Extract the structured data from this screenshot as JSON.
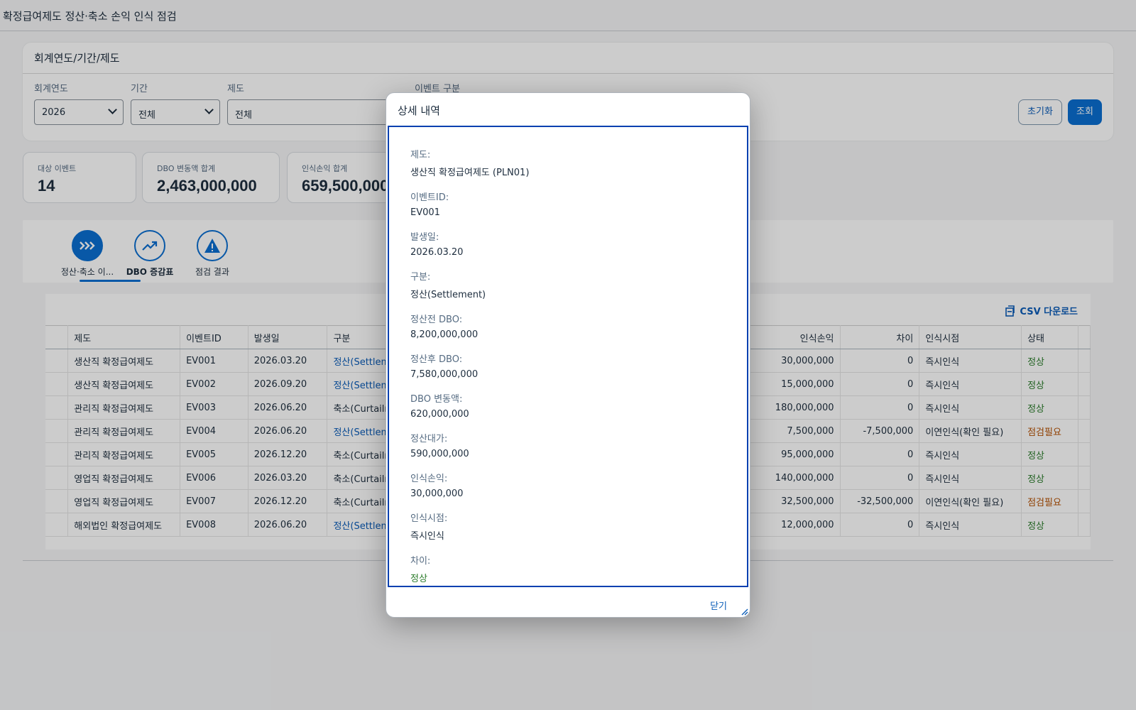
{
  "app": {
    "title": "확정급여제도 정산·축소 손익 인식 점검"
  },
  "filter": {
    "header": "회계연도/기간/제도",
    "year_label": "회계연도",
    "year_value": "2026",
    "period_label": "기간",
    "period_value": "전체",
    "plan_label": "제도",
    "plan_value": "전체",
    "event_label": "이벤트 구분",
    "reset_label": "초기화",
    "search_label": "조회"
  },
  "kpis": [
    {
      "label": "대상 이벤트",
      "value": "14"
    },
    {
      "label": "DBO 변동액 합계",
      "value": "2,463,000,000"
    },
    {
      "label": "인식손익 합계",
      "value": "659,500,000"
    }
  ],
  "tabs": [
    {
      "label": "정산·축소 이...",
      "icon": "chevrons-right-icon"
    },
    {
      "label": "DBO 증감표",
      "icon": "trend-up-icon"
    },
    {
      "label": "점검 결과",
      "icon": "warning-icon"
    }
  ],
  "table": {
    "csv_label": "CSV 다운로드",
    "headers": {
      "plan": "제도",
      "event_id": "이벤트ID",
      "date": "발생일",
      "type": "구분",
      "gain": "인식손익",
      "diff": "차이",
      "timing": "인식시점",
      "status": "상태"
    },
    "rows": [
      {
        "plan": "생산직 확정급여제도",
        "event_id": "EV001",
        "date": "2026.03.20",
        "type": "정산(Settlement)",
        "gain": "30,000,000",
        "diff": "0",
        "timing": "즉시인식",
        "status": "정상"
      },
      {
        "plan": "생산직 확정급여제도",
        "event_id": "EV002",
        "date": "2026.09.20",
        "type": "정산(Settlement)",
        "gain": "15,000,000",
        "diff": "0",
        "timing": "즉시인식",
        "status": "정상"
      },
      {
        "plan": "관리직 확정급여제도",
        "event_id": "EV003",
        "date": "2026.06.20",
        "type": "축소(Curtailment)",
        "gain": "180,000,000",
        "diff": "0",
        "timing": "즉시인식",
        "status": "정상"
      },
      {
        "plan": "관리직 확정급여제도",
        "event_id": "EV004",
        "date": "2026.06.20",
        "type": "정산(Settlement)",
        "gain": "7,500,000",
        "diff": "-7,500,000",
        "timing": "이연인식(확인 필요)",
        "status": "점검필요"
      },
      {
        "plan": "관리직 확정급여제도",
        "event_id": "EV005",
        "date": "2026.12.20",
        "type": "축소(Curtailment)",
        "gain": "95,000,000",
        "diff": "0",
        "timing": "즉시인식",
        "status": "정상"
      },
      {
        "plan": "영업직 확정급여제도",
        "event_id": "EV006",
        "date": "2026.03.20",
        "type": "축소(Curtailment)",
        "gain": "140,000,000",
        "diff": "0",
        "timing": "즉시인식",
        "status": "정상"
      },
      {
        "plan": "영업직 확정급여제도",
        "event_id": "EV007",
        "date": "2026.12.20",
        "type": "축소(Curtailment)",
        "gain": "32,500,000",
        "diff": "-32,500,000",
        "timing": "이연인식(확인 필요)",
        "status": "점검필요"
      },
      {
        "plan": "해외법인 확정급여제도",
        "event_id": "EV008",
        "date": "2026.06.20",
        "type": "정산(Settlement)",
        "gain": "12,000,000",
        "diff": "0",
        "timing": "즉시인식",
        "status": "정상"
      }
    ]
  },
  "dialog": {
    "title": "상세 내역",
    "fields": [
      {
        "label": "제도:",
        "value": "생산직 확정급여제도 (PLN01)"
      },
      {
        "label": "이벤트ID:",
        "value": "EV001"
      },
      {
        "label": "발생일:",
        "value": "2026.03.20"
      },
      {
        "label": "구분:",
        "value": "정산(Settlement)"
      },
      {
        "label": "정산전 DBO:",
        "value": "8,200,000,000"
      },
      {
        "label": "정산후 DBO:",
        "value": "7,580,000,000"
      },
      {
        "label": "DBO 변동액:",
        "value": "620,000,000"
      },
      {
        "label": "정산대가:",
        "value": "590,000,000"
      },
      {
        "label": "인식손익:",
        "value": "30,000,000"
      },
      {
        "label": "인식시점:",
        "value": "즉시인식"
      },
      {
        "label": "차이:",
        "value": "정상"
      }
    ],
    "close_label": "닫기"
  },
  "colors": {
    "accent": "#0a6ed1",
    "ok": "#2b7c2b",
    "warn": "#b44f00",
    "dialog_border": "#0040b0"
  }
}
